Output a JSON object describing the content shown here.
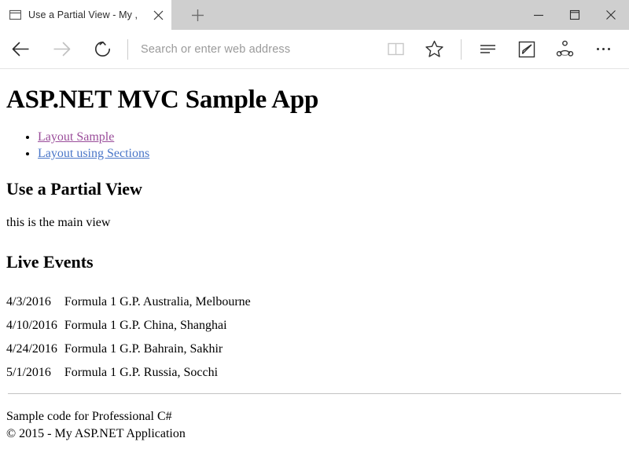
{
  "browser": {
    "tab": {
      "title": "Use a Partial View - My ,",
      "favicon_icon": "page-icon",
      "close_icon": "close-icon"
    },
    "new_tab": {
      "icon": "plus-icon",
      "label": "+"
    },
    "window_controls": {
      "minimize_icon": "minimize-icon",
      "maximize_icon": "maximize-icon",
      "close_icon": "close-icon"
    },
    "navigation": {
      "back_icon": "back-arrow-icon",
      "forward_icon": "forward-arrow-icon",
      "refresh_icon": "refresh-icon"
    },
    "address_bar": {
      "value": "",
      "placeholder": "Search or enter web address"
    },
    "toolbar": {
      "reading_view_icon": "book-icon",
      "favorites_icon": "star-icon",
      "hub_icon": "hub-lines-icon",
      "web_note_icon": "pen-square-icon",
      "share_icon": "share-icon",
      "more_icon": "ellipsis-icon"
    },
    "colors": {
      "tabstrip_inactive": "#cfcfcf",
      "chrome_bg": "#ffffff",
      "placeholder_text": "#9a9a9a"
    }
  },
  "content": {
    "site_title": "ASP.NET MVC Sample App",
    "nav_links": [
      {
        "label": "Layout Sample",
        "state": "visited",
        "color": "#9a4d9a"
      },
      {
        "label": "Layout using Sections",
        "state": "unvisited",
        "color": "#4a76c8"
      }
    ],
    "page_heading": "Use a Partial View",
    "lead_text": "this is the main view",
    "events_heading": "Live Events",
    "events_table": {
      "columns": [
        "date",
        "event"
      ],
      "rows": [
        {
          "date": "4/3/2016",
          "event": "Formula 1 G.P. Australia, Melbourne"
        },
        {
          "date": "4/10/2016",
          "event": "Formula 1 G.P. China, Shanghai"
        },
        {
          "date": "4/24/2016",
          "event": "Formula 1 G.P. Bahrain, Sakhir"
        },
        {
          "date": "5/1/2016",
          "event": "Formula 1 G.P. Russia, Socchi"
        }
      ]
    },
    "footer": {
      "line1": "Sample code for Professional C#",
      "line2": "© 2015 - My ASP.NET Application"
    }
  }
}
